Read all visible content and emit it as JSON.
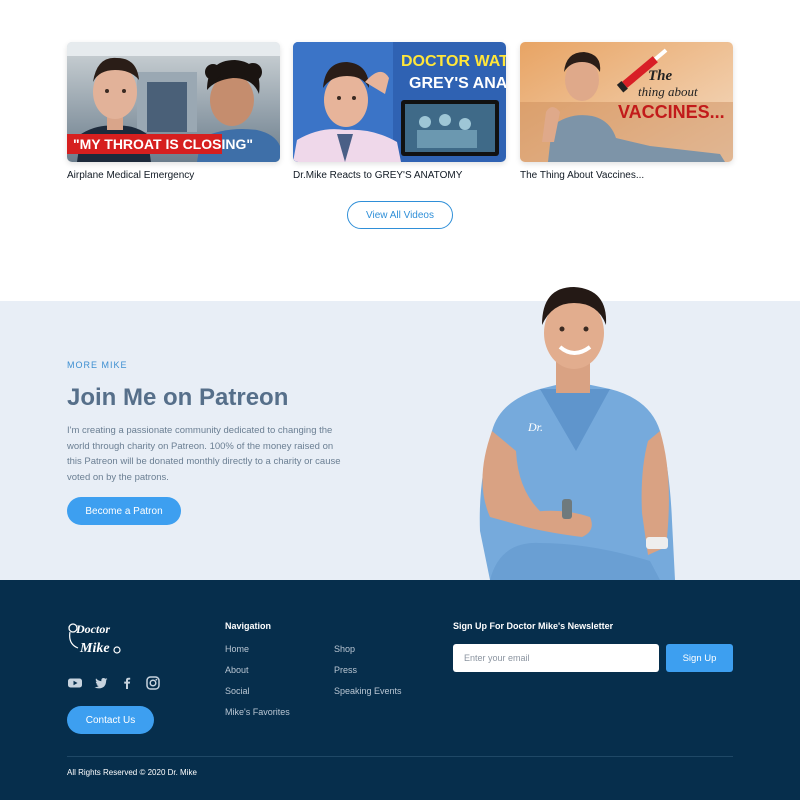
{
  "videos": {
    "items": [
      {
        "title": "Airplane Medical Emergency",
        "overlay_text": "\"MY THROAT IS CLOSING\""
      },
      {
        "title": "Dr.Mike Reacts to GREY'S ANATOMY",
        "overlay_line1": "DOCTOR WATCHES",
        "overlay_line2": "GREY'S ANATOMY"
      },
      {
        "title": "The Thing About Vaccines...",
        "overlay_line1": "The",
        "overlay_line2": "thing about",
        "overlay_line3": "VACCINES..."
      }
    ],
    "view_all_label": "View All Videos"
  },
  "patreon": {
    "eyebrow": "MORE MIKE",
    "heading": "Join Me on Patreon",
    "body": "I'm creating a passionate community dedicated to changing the world through charity on Patreon. 100% of the money raised on this Patreon will be donated monthly directly to a charity or cause voted on by the patrons.",
    "button_label": "Become a Patron"
  },
  "footer": {
    "logo_line1": "Doctor",
    "logo_line2": "Mike",
    "social_icons": [
      "youtube-icon",
      "twitter-icon",
      "facebook-icon",
      "instagram-icon"
    ],
    "contact_label": "Contact Us",
    "nav_heading": "Navigation",
    "nav_col1": [
      "Home",
      "About",
      "Social",
      "Mike's Favorites"
    ],
    "nav_col2": [
      "Shop",
      "Press",
      "Speaking Events"
    ],
    "newsletter_heading": "Sign Up For Doctor Mike's Newsletter",
    "email_placeholder": "Enter your email",
    "signup_label": "Sign Up",
    "copyright": "All Rights Reserved © 2020 Dr. Mike"
  },
  "colors": {
    "accent": "#3d9ff0",
    "footer_bg": "#062e4c",
    "patreon_bg": "#e8eef6"
  }
}
